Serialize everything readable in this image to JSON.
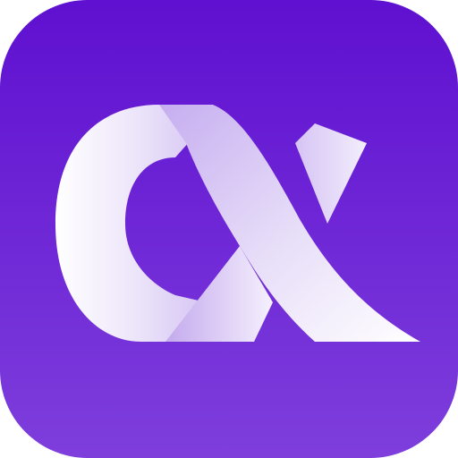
{
  "app_icon": {
    "name": "alpha-icon",
    "glyph": "α",
    "colors": {
      "background_top": "#5F10D0",
      "background_bottom": "#7E3EDC",
      "glyph_light": "#FFFFFF",
      "glyph_tint": "#E2D8F6",
      "glyph_shadow": "#C6AEF0"
    }
  }
}
